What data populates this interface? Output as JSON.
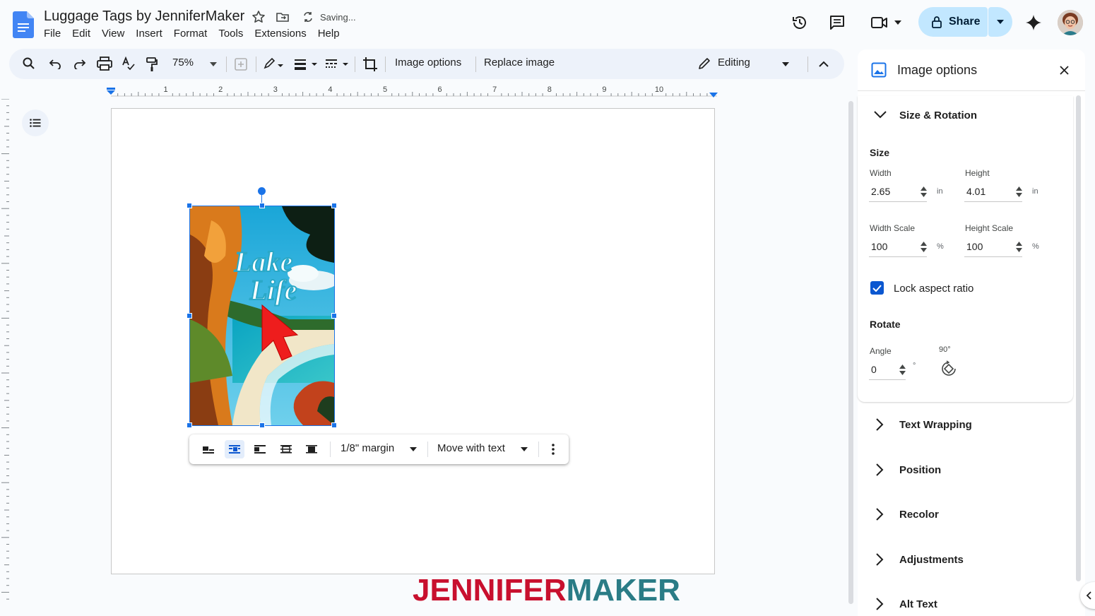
{
  "header": {
    "doc_title": "Luggage Tags by JenniferMaker",
    "status": "Saving...",
    "share_label": "Share",
    "menu": [
      "File",
      "Edit",
      "View",
      "Insert",
      "Format",
      "Tools",
      "Extensions",
      "Help"
    ]
  },
  "toolbar": {
    "zoom": "75%",
    "image_options_label": "Image options",
    "replace_image_label": "Replace image",
    "mode_label": "Editing"
  },
  "ruler": {
    "labels": [
      "1",
      "2",
      "3",
      "4",
      "5",
      "6",
      "7",
      "8",
      "9",
      "10"
    ]
  },
  "image": {
    "text_line1": "Lake",
    "text_line2": "Life"
  },
  "image_toolbar": {
    "margin_label": "1/8\" margin",
    "position_label": "Move with text"
  },
  "panel": {
    "title": "Image options",
    "size_rotation": "Size & Rotation",
    "size": "Size",
    "width_label": "Width",
    "width_value": "2.65",
    "height_label": "Height",
    "height_value": "4.01",
    "unit_in": "in",
    "width_scale_label": "Width Scale",
    "width_scale_value": "100",
    "height_scale_label": "Height Scale",
    "height_scale_value": "100",
    "unit_pct": "%",
    "lock_label": "Lock aspect ratio",
    "lock_checked": true,
    "rotate": "Rotate",
    "angle_label": "Angle",
    "angle_value": "0",
    "unit_deg": "°",
    "rotate90_label": "90°",
    "sections": [
      "Text Wrapping",
      "Position",
      "Recolor",
      "Adjustments",
      "Alt Text"
    ]
  },
  "watermark": {
    "part1": "JENNIFER",
    "part2": "MAKER",
    "color1": "#c8102e",
    "color2": "#2a7c86"
  },
  "colors": {
    "accent": "#1a73e8",
    "share_bg": "#c2e7ff",
    "toolbar_bg": "#edf2fa"
  }
}
